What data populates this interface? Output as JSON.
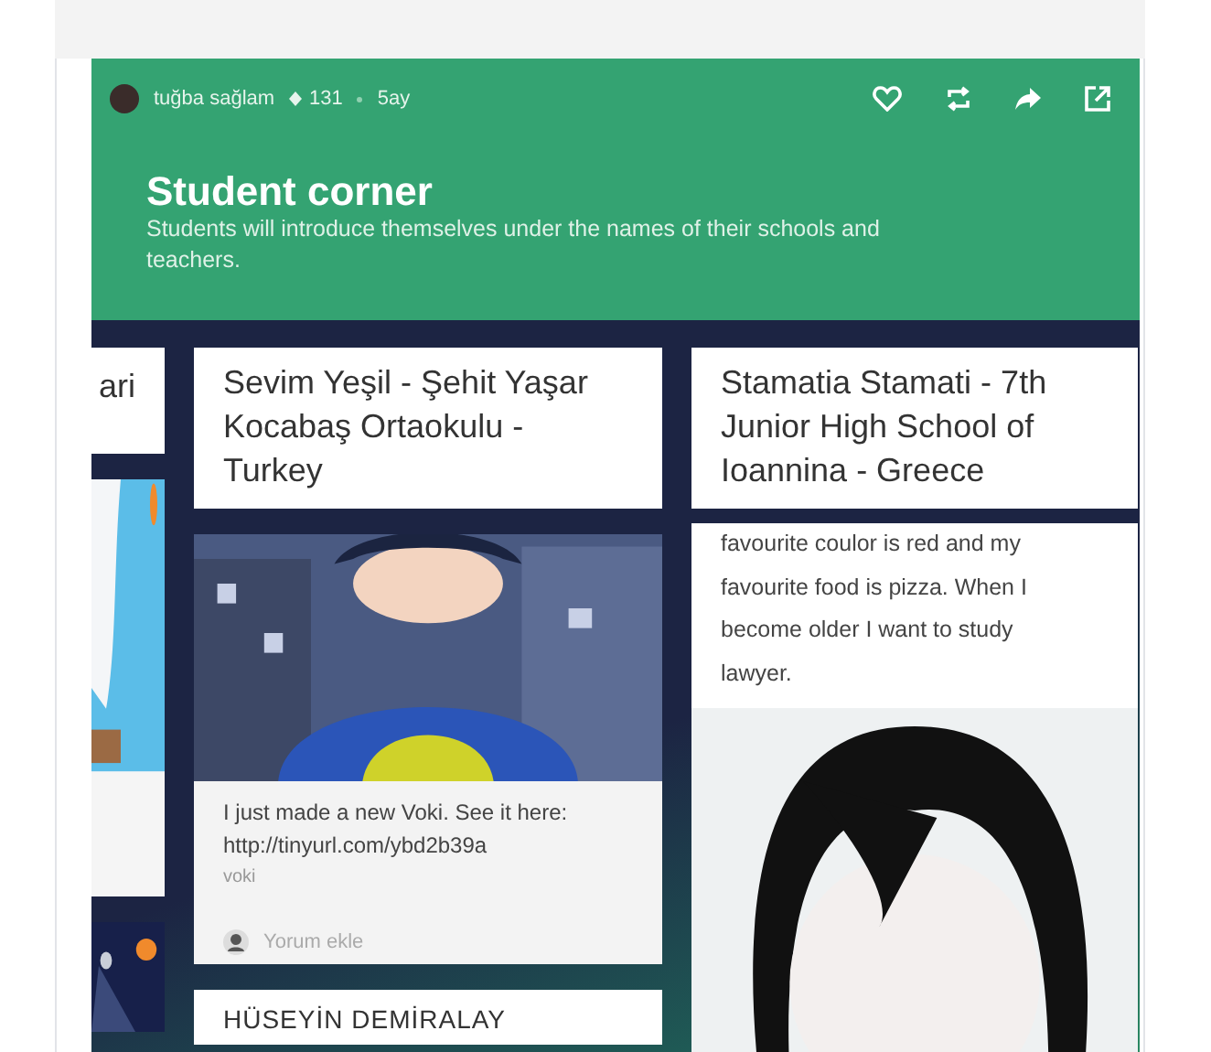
{
  "post_meta": {
    "author": "tuğba sağlam",
    "score": "131",
    "age": "5ay"
  },
  "header": {
    "title": "Student corner",
    "description": "Students will introduce themselves under the names of their schools and teachers."
  },
  "columns": [
    {
      "cards": [
        {
          "kind": "title",
          "text": "ari"
        },
        {
          "kind": "picture"
        },
        {
          "kind": "picture"
        }
      ]
    },
    {
      "cards": [
        {
          "kind": "title",
          "text": "Sevim Yeşil - Şehit Yaşar Kocabaş Ortaokulu - Turkey"
        },
        {
          "kind": "post",
          "lines": [
            "I just made a new Voki. See it here:",
            "http://tinyurl.com/ybd2b39a"
          ],
          "source": "voki",
          "comment_placeholder": "Yorum ekle"
        },
        {
          "kind": "heading",
          "text": "HÜSEYİN DEMİRALAY"
        }
      ]
    },
    {
      "cards": [
        {
          "kind": "title",
          "text": "Stamatia Stamati - 7th Junior High School of Ioannina - Greece"
        },
        {
          "kind": "text_post",
          "lines": [
            "favourite coulor is red and my",
            "favourite food is pizza. When I",
            "become older I want to study",
            "lawyer."
          ]
        }
      ]
    }
  ]
}
